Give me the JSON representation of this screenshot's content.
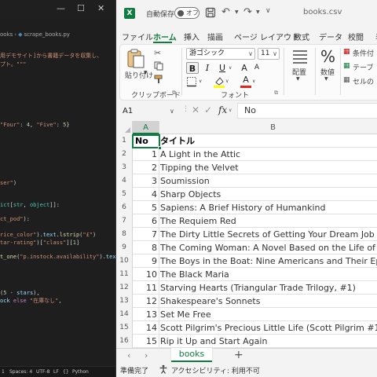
{
  "vscode": {
    "window_controls": {
      "minimize": "—",
      "maximize": "☐",
      "close": "✕"
    },
    "breadcrumb": {
      "folder": "ooks",
      "separator": "›",
      "file": "scrape_books.py"
    },
    "code_lines": [
      "用デモサイト]から書籍データを収集し、",
      "プト。\"\"\"",
      "\"Four\": 4, \"Five\": 5}",
      "ser\")",
      "ict[str, object]]:",
      "ct_pod\"):",
      "rice_color\").text.lstrip(\"£\")",
      "tar-rating\")[\"class\"][1]",
      "t_one(\"p.instock.availability\").text",
      "(5 - stars),",
      "ock else \"在庫なし\","
    ],
    "statusbar": {
      "position": "1",
      "spaces": "Spaces: 4",
      "encoding": "UTF-8",
      "eol": "LF",
      "braces": "{}",
      "language": "Python"
    }
  },
  "excel": {
    "title": {
      "autosave_label": "自動保存",
      "autosave_state": "オフ",
      "filename": "books.csv",
      "more": "∨"
    },
    "menu": [
      "ファイル",
      "ホーム",
      "挿入",
      "描画",
      "ページ レイアウト",
      "数式",
      "データ",
      "校閲",
      "表示"
    ],
    "active_menu": "ホーム",
    "ribbon": {
      "paste_label": "貼り付け",
      "clipboard_label": "クリップボード",
      "font_name": "游ゴシック",
      "font_size": "11",
      "font_label": "フォント",
      "grow_font": "A",
      "shrink_font": "A",
      "bold": "B",
      "italic": "I",
      "underline": "U",
      "align_label": "配置",
      "number_label": "数値",
      "number_icon": "%",
      "styles": [
        "条件付",
        "テーブ",
        "セルの"
      ]
    },
    "formula_bar": {
      "name_box": "A1",
      "content": "No"
    },
    "columns": [
      "A",
      "B"
    ],
    "rows": [
      {
        "num": "1",
        "a": "No",
        "b": "タイトル"
      },
      {
        "num": "2",
        "a": "1",
        "b": "A Light in the Attic"
      },
      {
        "num": "3",
        "a": "2",
        "b": "Tipping the Velvet"
      },
      {
        "num": "4",
        "a": "3",
        "b": "Soumission"
      },
      {
        "num": "5",
        "a": "4",
        "b": "Sharp Objects"
      },
      {
        "num": "6",
        "a": "5",
        "b": "Sapiens: A Brief History of Humankind"
      },
      {
        "num": "7",
        "a": "6",
        "b": "The Requiem Red"
      },
      {
        "num": "8",
        "a": "7",
        "b": "The Dirty Little Secrets of Getting Your Dream Job"
      },
      {
        "num": "9",
        "a": "8",
        "b": "The Coming Woman: A Novel Based on the Life of the Infam"
      },
      {
        "num": "10",
        "a": "9",
        "b": "The Boys in the Boat: Nine Americans and Their Epic Quest"
      },
      {
        "num": "11",
        "a": "10",
        "b": "The Black Maria"
      },
      {
        "num": "12",
        "a": "11",
        "b": "Starving Hearts (Triangular Trade Trilogy, #1)"
      },
      {
        "num": "13",
        "a": "12",
        "b": "Shakespeare's Sonnets"
      },
      {
        "num": "14",
        "a": "13",
        "b": "Set Me Free"
      },
      {
        "num": "15",
        "a": "14",
        "b": "Scott Pilgrim's Precious Little Life (Scott Pilgrim #1)"
      },
      {
        "num": "16",
        "a": "15",
        "b": "Rip it Up and Start Again"
      }
    ],
    "sheet_tab": "books",
    "sheet_add": "+",
    "sheet_prev": "‹",
    "sheet_next": "›",
    "status": {
      "ready": "準備完了",
      "accessibility": "アクセシビリティ: 利用不可"
    },
    "accent_color": "#107c41"
  }
}
